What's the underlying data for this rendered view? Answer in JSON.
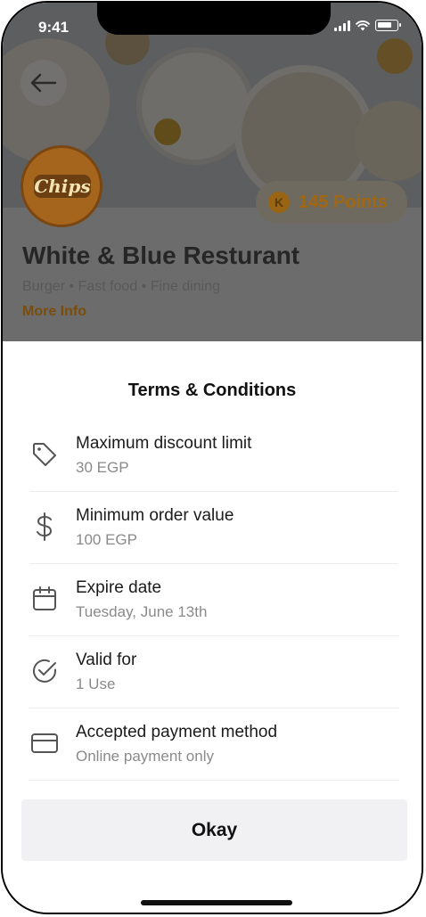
{
  "status_bar": {
    "time": "9:41"
  },
  "restaurant": {
    "logo_text": "Chips",
    "points": "145 Points",
    "points_badge": "K",
    "name": "White & Blue Resturant",
    "tags": "Burger • Fast food • Fine dining",
    "more_info": "More Info"
  },
  "sheet": {
    "title": "Terms & Conditions",
    "items": [
      {
        "icon": "tag-icon",
        "label": "Maximum discount limit",
        "value": "30 EGP"
      },
      {
        "icon": "dollar-icon",
        "label": "Minimum order value",
        "value": "100 EGP"
      },
      {
        "icon": "calendar-icon",
        "label": "Expire date",
        "value": "Tuesday, June 13th"
      },
      {
        "icon": "check-circle-icon",
        "label": "Valid for",
        "value": "1 Use"
      },
      {
        "icon": "credit-card-icon",
        "label": "Accepted payment method",
        "value": "Online payment only"
      }
    ],
    "button_label": "Okay"
  },
  "colors": {
    "accent_gold": "#a2660f",
    "overlay": "#6c6c6c",
    "button_bg": "#f1f1f4"
  }
}
